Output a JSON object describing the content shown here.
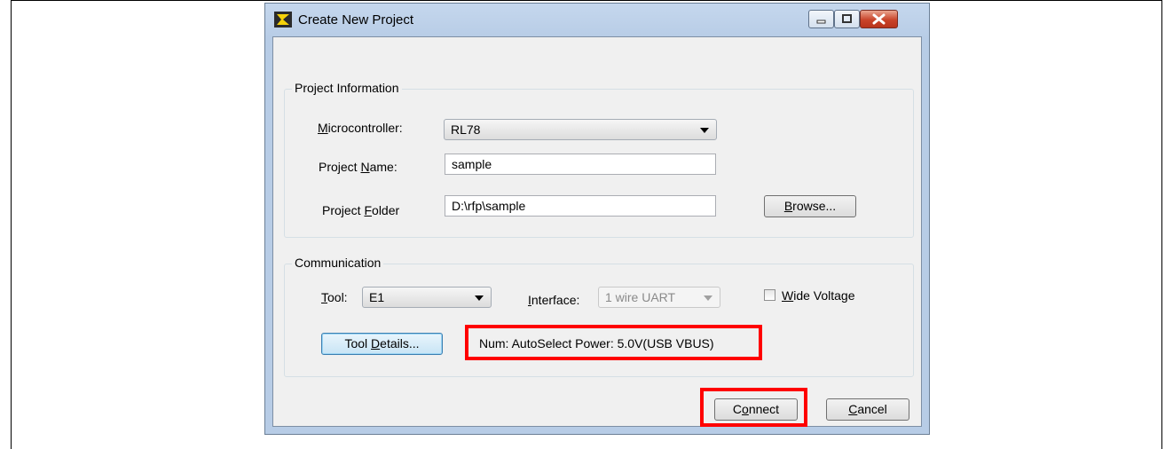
{
  "window": {
    "title": "Create New Project"
  },
  "project_information": {
    "group_label": "Project Information",
    "microcontroller_label_pre": "",
    "microcontroller_label_key": "M",
    "microcontroller_label_post": "icrocontroller:",
    "microcontroller_value": "RL78",
    "project_name_label_pre": "Project ",
    "project_name_label_key": "N",
    "project_name_label_post": "ame:",
    "project_name_value": "sample",
    "project_folder_label_pre": "Project ",
    "project_folder_label_key": "F",
    "project_folder_label_post": "older",
    "project_folder_value": "D:\\rfp\\sample",
    "browse_key": "B",
    "browse_post": "rowse..."
  },
  "communication": {
    "group_label": "Communication",
    "tool_label_key": "T",
    "tool_label_post": "ool:",
    "tool_value": "E1",
    "interface_label_key": "I",
    "interface_label_post": "nterface:",
    "interface_value": "1 wire UART",
    "wide_voltage_key": "W",
    "wide_voltage_post": "ide Voltage",
    "wide_voltage_checked": false,
    "tool_details_pre": "Tool ",
    "tool_details_key": "D",
    "tool_details_post": "etails...",
    "status_text": "Num: AutoSelect  Power: 5.0V(USB VBUS)"
  },
  "footer": {
    "connect_pre": "C",
    "connect_key": "o",
    "connect_post": "nnect",
    "cancel_key": "C",
    "cancel_post": "ancel"
  },
  "colors": {
    "highlight": "#ff0000"
  }
}
